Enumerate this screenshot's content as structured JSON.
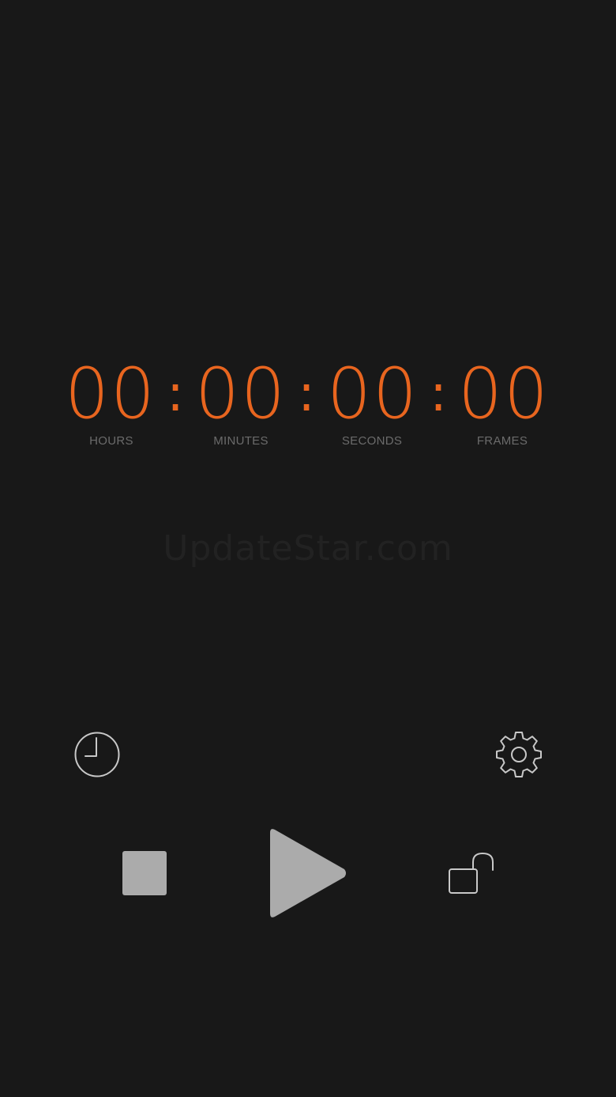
{
  "timecode": {
    "hours": "00",
    "minutes": "00",
    "seconds": "00",
    "frames": "00",
    "separator": ":",
    "labels": {
      "hours": "HOURS",
      "minutes": "MINUTES",
      "seconds": "SECONDS",
      "frames": "FRAMES"
    }
  },
  "watermark": "UpdateStar.com",
  "icons": {
    "history": "clock-icon",
    "settings": "gear-icon",
    "stop": "stop-icon",
    "play": "play-icon",
    "lock": "unlock-icon"
  },
  "colors": {
    "background": "#181818",
    "accent": "#e8651f",
    "label": "#6b6b6b",
    "control": "#ababab",
    "outline": "#c8c8c8"
  }
}
